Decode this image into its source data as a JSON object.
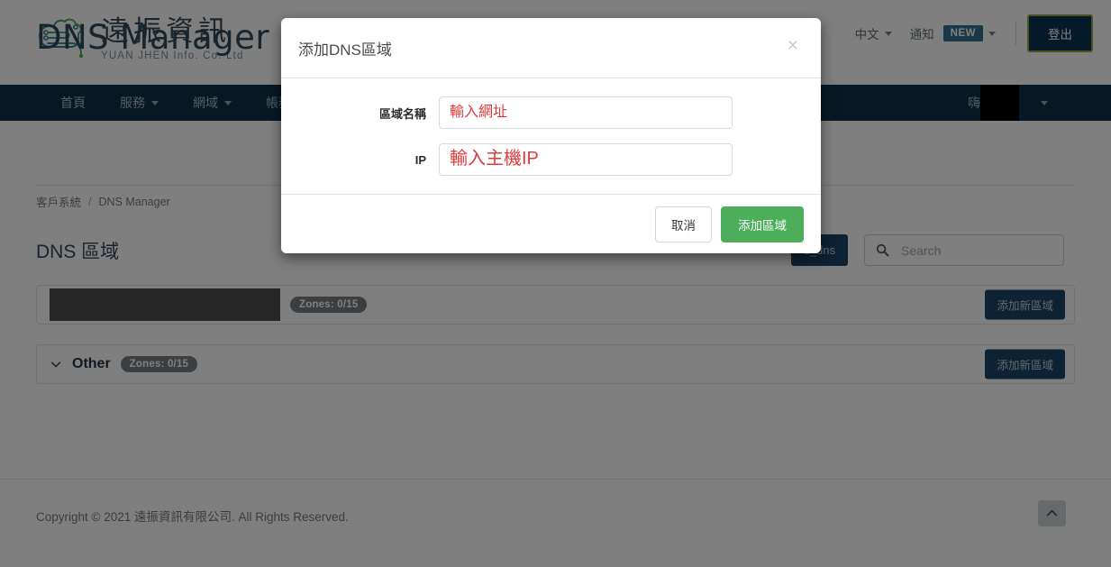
{
  "header": {
    "logo": {
      "title": "遠振資訊",
      "subtitle": "YUAN JHEN Info. Co. Ltd",
      "icon": "cloud-circuit-logo"
    },
    "lang_label": "中文",
    "notify_label": "通知",
    "notify_badge": "NEW",
    "logout_label": "登出"
  },
  "navbar": {
    "items": [
      {
        "label": "首頁",
        "has_caret": false
      },
      {
        "label": "服務",
        "has_caret": true
      },
      {
        "label": "網域",
        "has_caret": true
      },
      {
        "label": "帳務",
        "has_caret": true
      }
    ],
    "greeting": "嗨",
    "user_name_redacted": ""
  },
  "page": {
    "title": "DNS Manager",
    "breadcrumb": {
      "root": "客戶系統",
      "separator": "/",
      "current": "DNS Manager"
    },
    "section_title": "DNS 區域"
  },
  "toolbar": {
    "zone_filter_label": "s_dns",
    "search_placeholder": "Search",
    "search_value": ""
  },
  "zones": [
    {
      "name": "",
      "name_redacted": true,
      "badge": "Zones: 0/15",
      "add_label": "添加新區域",
      "chevron": false
    },
    {
      "name": "Other",
      "name_redacted": false,
      "badge": "Zones: 0/15",
      "add_label": "添加新區域",
      "chevron": true
    }
  ],
  "footer": {
    "copyright": "Copyright © 2021 遠振資訊有限公司. All Rights Reserved."
  },
  "modal": {
    "title": "添加DNS區域",
    "close_label": "×",
    "fields": [
      {
        "label": "區域名稱",
        "placeholder": "輸入網址",
        "value": ""
      },
      {
        "label": "IP",
        "placeholder": "輸入主機IP",
        "value": ""
      }
    ],
    "cancel_label": "取消",
    "submit_label": "添加區域"
  },
  "colors": {
    "navy": "#0d3247",
    "button_navy": "#1a4565",
    "green": "#4cae5a",
    "placeholder_red": "#e03b3b",
    "badge_new": "#31708f",
    "badge_gray": "#777f85"
  }
}
